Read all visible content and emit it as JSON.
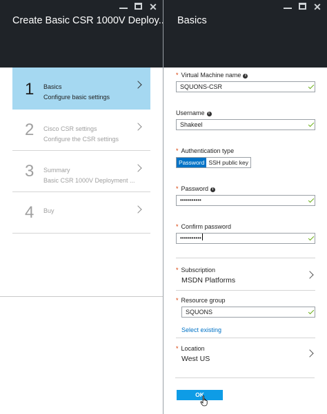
{
  "left_blade": {
    "title": "Create Basic CSR 1000V Deploy...",
    "steps": [
      {
        "num": "1",
        "title": "Basics",
        "subtitle": "Configure basic settings",
        "active": true
      },
      {
        "num": "2",
        "title": "Cisco CSR settings",
        "subtitle": "Configure the CSR settings",
        "active": false
      },
      {
        "num": "3",
        "title": "Summary",
        "subtitle": "Basic CSR 1000V Deployment ...",
        "active": false
      },
      {
        "num": "4",
        "title": "Buy",
        "subtitle": "",
        "active": false
      }
    ]
  },
  "right_blade": {
    "title": "Basics",
    "vm_name": {
      "label": "Virtual Machine name",
      "value": "SQUONS-CSR"
    },
    "username": {
      "label": "Username",
      "value": "Shakeel"
    },
    "auth_type": {
      "label": "Authentication type",
      "options": [
        "Password",
        "SSH public key"
      ],
      "selected": "Password"
    },
    "password": {
      "label": "Password",
      "value": "•••••••••••"
    },
    "confirm_password": {
      "label": "Confirm password",
      "value": "•••••••••••"
    },
    "subscription": {
      "label": "Subscription",
      "value": "MSDN Platforms"
    },
    "resource_group": {
      "label": "Resource group",
      "value": "SQUONS",
      "link": "Select existing"
    },
    "location": {
      "label": "Location",
      "value": "West US"
    },
    "ok_label": "OK"
  },
  "window_controls": {
    "minimize": "_",
    "maximize": "□",
    "close": "✕"
  },
  "colors": {
    "header_bg": "#1f2328",
    "active_step": "#a5d8f1",
    "accent": "#0072c6",
    "ok_button": "#0e9ce6",
    "check": "#6aaf17",
    "required": "#d83b01"
  }
}
